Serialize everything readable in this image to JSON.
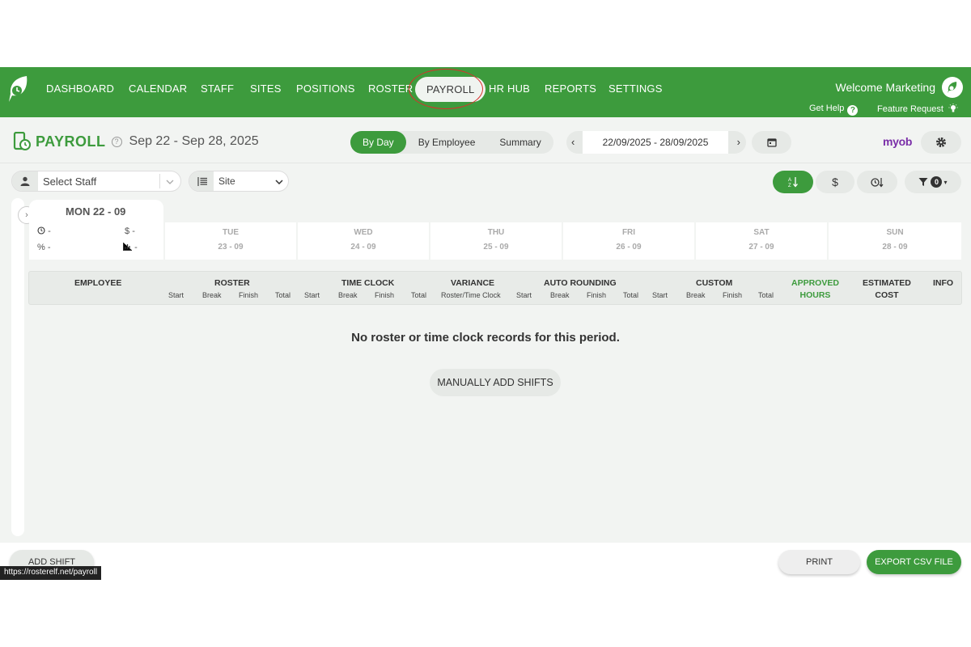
{
  "nav": {
    "items": [
      "DASHBOARD",
      "CALENDAR",
      "STAFF",
      "SITES",
      "POSITIONS",
      "ROSTER",
      "PAYROLL",
      "HR HUB",
      "REPORTS",
      "SETTINGS"
    ],
    "active": "PAYROLL",
    "welcome": "Welcome Marketing",
    "get_help": "Get Help",
    "feature_request": "Feature Request"
  },
  "header": {
    "title": "PAYROLL",
    "date_range": "Sep 22 - Sep 28, 2025",
    "view_tabs": [
      "By Day",
      "By Employee",
      "Summary"
    ],
    "active_view": "By Day",
    "date_input": "22/09/2025 - 28/09/2025",
    "integration": "myob"
  },
  "filters": {
    "staff_placeholder": "Select Staff",
    "site_label": "Site",
    "filter_count": "0"
  },
  "days": {
    "current": {
      "label": "MON 22 - 09",
      "hours": "-",
      "cost": "-",
      "percent": "-",
      "stats": "-"
    },
    "others": [
      {
        "name": "TUE",
        "date": "23 - 09"
      },
      {
        "name": "WED",
        "date": "24 - 09"
      },
      {
        "name": "THU",
        "date": "25 - 09"
      },
      {
        "name": "FRI",
        "date": "26 - 09"
      },
      {
        "name": "SAT",
        "date": "27 - 09"
      },
      {
        "name": "SUN",
        "date": "28 - 09"
      }
    ]
  },
  "table": {
    "employee": "EMPLOYEE",
    "roster": "ROSTER",
    "time_clock": "TIME CLOCK",
    "variance": "VARIANCE",
    "variance_sub": "Roster/Time Clock",
    "auto_rounding": "AUTO ROUNDING",
    "custom": "CUSTOM",
    "approved_1": "APPROVED",
    "approved_2": "HOURS",
    "estimated_1": "ESTIMATED",
    "estimated_2": "COST",
    "info": "INFO",
    "sub_start": "Start",
    "sub_break": "Break",
    "sub_finish": "Finish",
    "sub_total": "Total"
  },
  "empty": {
    "message": "No roster or time clock records for this period.",
    "manual_button": "MANUALLY ADD SHIFTS"
  },
  "footer": {
    "add_shift": "ADD SHIFT",
    "print": "PRINT",
    "export": "EXPORT CSV FILE"
  },
  "status_url": "https://rosterelf.net/payroll",
  "colors": {
    "brand": "#3d9b3d",
    "myob": "#7a2ea8",
    "highlight_circle": "#d9302c"
  }
}
